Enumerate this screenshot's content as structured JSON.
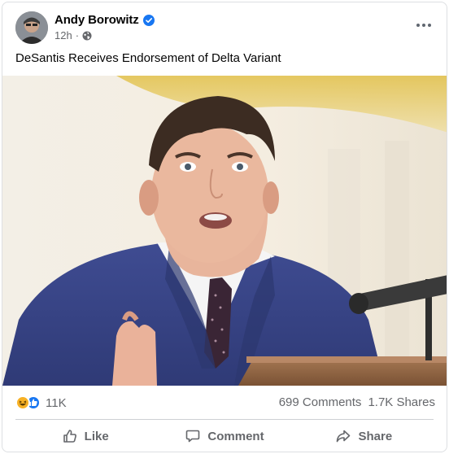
{
  "post": {
    "author": "Andy Borowitz",
    "time": "12h",
    "separator": "·",
    "text": "DeSantis Receives Endorsement of Delta Variant"
  },
  "icons": {
    "verified": "verified-badge-icon",
    "audience": "globe-icon",
    "more": "more-options-icon",
    "reactions": [
      "haha-reaction-icon",
      "like-reaction-icon"
    ],
    "like": "thumbs-up-icon",
    "comment": "comment-bubble-icon",
    "share": "share-arrow-icon"
  },
  "stats": {
    "reaction_count": "11K",
    "comments": "699 Comments",
    "shares": "1.7K Shares"
  },
  "actions": {
    "like": "Like",
    "comment": "Comment",
    "share": "Share"
  },
  "colors": {
    "accent": "#1877f2",
    "secondary_text": "#65676b",
    "haha": "#f7b125"
  }
}
